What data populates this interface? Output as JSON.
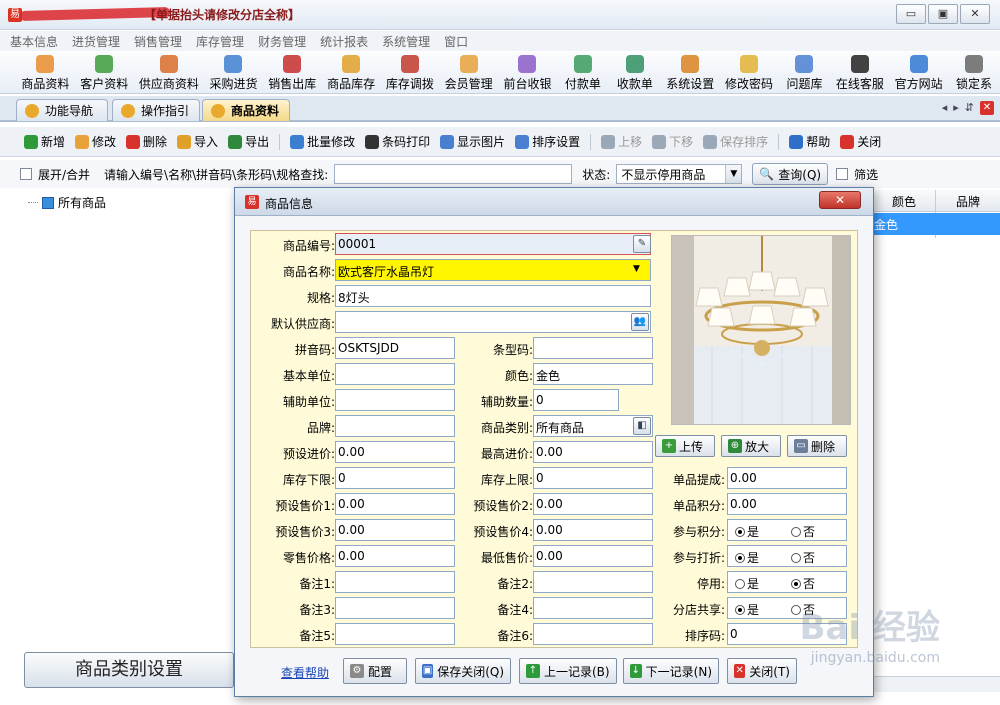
{
  "window": {
    "title": "【单据抬头请修改分店全称】",
    "controls": [
      "▭",
      "▣",
      "✕"
    ]
  },
  "menu": [
    "基本信息",
    "进货管理",
    "销售管理",
    "库存管理",
    "财务管理",
    "统计报表",
    "系统管理",
    "窗口"
  ],
  "toolbar": [
    {
      "label": "商品资料",
      "icon": "box-icon",
      "color": "#e98c2a"
    },
    {
      "label": "客户资料",
      "icon": "users-icon",
      "color": "#3a9b3a"
    },
    {
      "label": "供应商资料",
      "icon": "supplier-icon",
      "color": "#d96b2a"
    },
    {
      "label": "采购进货",
      "icon": "truck-icon",
      "color": "#3f7fd0"
    },
    {
      "label": "销售出库",
      "icon": "sale-icon",
      "color": "#c72d2d"
    },
    {
      "label": "商品库存",
      "icon": "stock-icon",
      "color": "#e0a02a"
    },
    {
      "label": "库存调拨",
      "icon": "transfer-icon",
      "color": "#c0392b"
    },
    {
      "label": "会员管理",
      "icon": "member-icon",
      "color": "#e6a13a"
    },
    {
      "label": "前台收银",
      "icon": "cashier-icon",
      "color": "#8b5cc7"
    },
    {
      "label": "付款单",
      "icon": "payment-icon",
      "color": "#3a9b5a"
    },
    {
      "label": "收款单",
      "icon": "receipt-icon",
      "color": "#2f8f5f"
    },
    {
      "label": "系统设置",
      "icon": "settings-icon",
      "color": "#d9821f"
    },
    {
      "label": "修改密码",
      "icon": "key-icon",
      "color": "#e2b233"
    },
    {
      "label": "问题库",
      "icon": "question-icon",
      "color": "#4a7fd0"
    },
    {
      "label": "在线客服",
      "icon": "qq-icon",
      "color": "#222222"
    },
    {
      "label": "官方网站",
      "icon": "ie-icon",
      "color": "#2f77d0"
    },
    {
      "label": "锁定系",
      "icon": "lock-icon",
      "color": "#666666"
    }
  ],
  "tabs": [
    {
      "label": "功能导航"
    },
    {
      "label": "操作指引"
    },
    {
      "label": "商品资料"
    }
  ],
  "subtoolbar": [
    {
      "label": "新增",
      "icon": "add-icon",
      "color": "#2e9a3a",
      "enabled": true
    },
    {
      "label": "修改",
      "icon": "edit-icon",
      "color": "#e7a33a",
      "enabled": true
    },
    {
      "label": "删除",
      "icon": "delete-icon",
      "color": "#d8322d",
      "enabled": true
    },
    {
      "label": "导入",
      "icon": "import-icon",
      "color": "#e0a02a",
      "enabled": true
    },
    {
      "label": "导出",
      "icon": "export-icon",
      "color": "#2e8a3a",
      "enabled": true
    },
    {
      "label": "批量修改",
      "icon": "batch-edit-icon",
      "color": "#3a7fd0",
      "enabled": true
    },
    {
      "label": "条码打印",
      "icon": "barcode-icon",
      "color": "#333333",
      "enabled": true
    },
    {
      "label": "显示图片",
      "icon": "image-icon",
      "color": "#4a7fd0",
      "enabled": true
    },
    {
      "label": "排序设置",
      "icon": "sort-icon",
      "color": "#4a7fd0",
      "enabled": true
    },
    {
      "label": "上移",
      "icon": "up-icon",
      "color": "#9aa8b8",
      "enabled": false
    },
    {
      "label": "下移",
      "icon": "down-icon",
      "color": "#9aa8b8",
      "enabled": false
    },
    {
      "label": "保存排序",
      "icon": "save-icon",
      "color": "#9aa8b8",
      "enabled": false
    },
    {
      "label": "帮助",
      "icon": "help-icon",
      "color": "#2f6fc7",
      "enabled": true
    },
    {
      "label": "关闭",
      "icon": "close-icon",
      "color": "#d8322d",
      "enabled": true
    }
  ],
  "filter": {
    "expand_label": "展开/合并",
    "search_label": "请输入编号\\名称\\拼音码\\条形码\\规格查找:",
    "search_value": "",
    "status_label": "状态:",
    "status_value": "不显示停用商品",
    "query_label": "查询(Q)",
    "filter_label": "筛选"
  },
  "tree": {
    "root": "所有商品"
  },
  "category_button": "商品类别设置",
  "grid": {
    "headers": [
      "颜色",
      "品牌"
    ],
    "row_value": "金色"
  },
  "dialog": {
    "title": "商品信息",
    "close": "✕",
    "fields": {
      "code": {
        "label": "商品编号:",
        "value": "00001"
      },
      "name": {
        "label": "商品名称:",
        "value": "欧式客厅水晶吊灯"
      },
      "spec": {
        "label": "规格:",
        "value": "8灯头"
      },
      "supplier": {
        "label": "默认供应商:",
        "value": ""
      },
      "pinyin": {
        "label": "拼音码:",
        "value": "OSKTSJDD"
      },
      "barcode": {
        "label": "条型码:",
        "value": ""
      },
      "base_unit": {
        "label": "基本单位:",
        "value": ""
      },
      "color": {
        "label": "颜色:",
        "value": "金色"
      },
      "aux_unit": {
        "label": "辅助单位:",
        "value": ""
      },
      "aux_qty": {
        "label": "辅助数量:",
        "value": "0"
      },
      "brand": {
        "label": "品牌:",
        "value": ""
      },
      "category": {
        "label": "商品类别:",
        "value": "所有商品"
      },
      "preset_cost": {
        "label": "预设进价:",
        "value": "0.00"
      },
      "max_cost": {
        "label": "最高进价:",
        "value": "0.00"
      },
      "stock_min": {
        "label": "库存下限:",
        "value": "0"
      },
      "stock_max": {
        "label": "库存上限:",
        "value": "0"
      },
      "price1": {
        "label": "预设售价1:",
        "value": "0.00"
      },
      "price2": {
        "label": "预设售价2:",
        "value": "0.00"
      },
      "price3": {
        "label": "预设售价3:",
        "value": "0.00"
      },
      "price4": {
        "label": "预设售价4:",
        "value": "0.00"
      },
      "retail": {
        "label": "零售价格:",
        "value": "0.00"
      },
      "min_price": {
        "label": "最低售价:",
        "value": "0.00"
      },
      "note1": {
        "label": "备注1:",
        "value": ""
      },
      "note2": {
        "label": "备注2:",
        "value": ""
      },
      "note3": {
        "label": "备注3:",
        "value": ""
      },
      "note4": {
        "label": "备注4:",
        "value": ""
      },
      "note5": {
        "label": "备注5:",
        "value": ""
      },
      "note6": {
        "label": "备注6:",
        "value": ""
      },
      "commission": {
        "label": "单品提成:",
        "value": "0.00"
      },
      "points": {
        "label": "单品积分:",
        "value": "0.00"
      },
      "sort_code": {
        "label": "排序码:",
        "value": "0"
      }
    },
    "radios": {
      "join_points": {
        "label": "参与积分:",
        "yes": "是",
        "no": "否",
        "selected": "yes"
      },
      "join_discount": {
        "label": "参与打折:",
        "yes": "是",
        "no": "否",
        "selected": "yes"
      },
      "disabled": {
        "label": "停用:",
        "yes": "是",
        "no": "否",
        "selected": "no"
      },
      "branch_share": {
        "label": "分店共享:",
        "yes": "是",
        "no": "否",
        "selected": "yes"
      }
    },
    "photo_buttons": [
      "上传",
      "放大",
      "删除"
    ],
    "footer": {
      "help": "查看帮助",
      "config": "配置",
      "save_close": "保存关闭(Q)",
      "prev": "上一记录(B)",
      "next": "下一记录(N)",
      "close": "关闭(T)"
    }
  },
  "watermark": {
    "main": "Bai 经验",
    "sub": "jingyan.baidu.com"
  }
}
